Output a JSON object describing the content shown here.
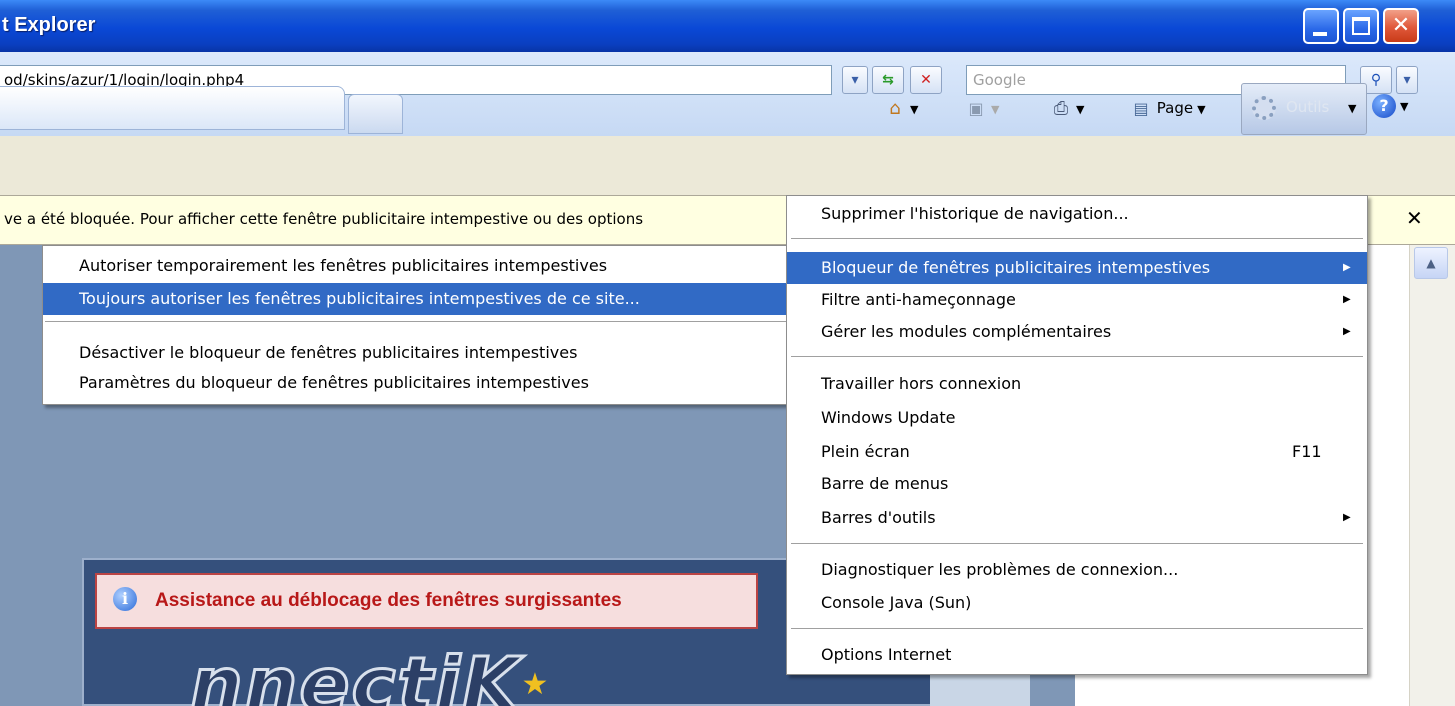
{
  "window": {
    "title": "t Explorer"
  },
  "address": {
    "url": "od/skins/azur/1/login/login.php4",
    "search_placeholder": "Google"
  },
  "commandbar": {
    "page_label": "Page",
    "tools_label": "Outils"
  },
  "infobar": {
    "text": "ve a été bloquée. Pour afficher cette fenêtre publicitaire intempestive ou des options"
  },
  "popup_menu": {
    "items": [
      "Autoriser temporairement les fenêtres publicitaires intempestives",
      "Toujours autoriser les fenêtres publicitaires intempestives de ce site...",
      "Désactiver le bloqueur de fenêtres publicitaires intempestives",
      "Paramètres du bloqueur de fenêtres publicitaires intempestives"
    ]
  },
  "tools_menu": {
    "items": [
      "Supprimer l'historique de navigation...",
      "Bloqueur de fenêtres publicitaires intempestives",
      "Filtre anti-hameçonnage",
      "Gérer les modules complémentaires",
      "Travailler hors connexion",
      "Windows Update",
      "Plein écran",
      "Barre de menus",
      "Barres d'outils",
      "Diagnostiquer les problèmes de connexion...",
      "Console Java (Sun)",
      "Options Internet"
    ],
    "shortcut_fullscreen": "F11"
  },
  "page": {
    "assist_text": "Assistance au déblocage des fenêtres surgissantes",
    "logo_text": "nnectiK"
  },
  "colors": {
    "selection": "#316ac5",
    "titlebar": "#0a48d6",
    "infobar": "#ffffe1",
    "assist_text": "#b81818"
  }
}
